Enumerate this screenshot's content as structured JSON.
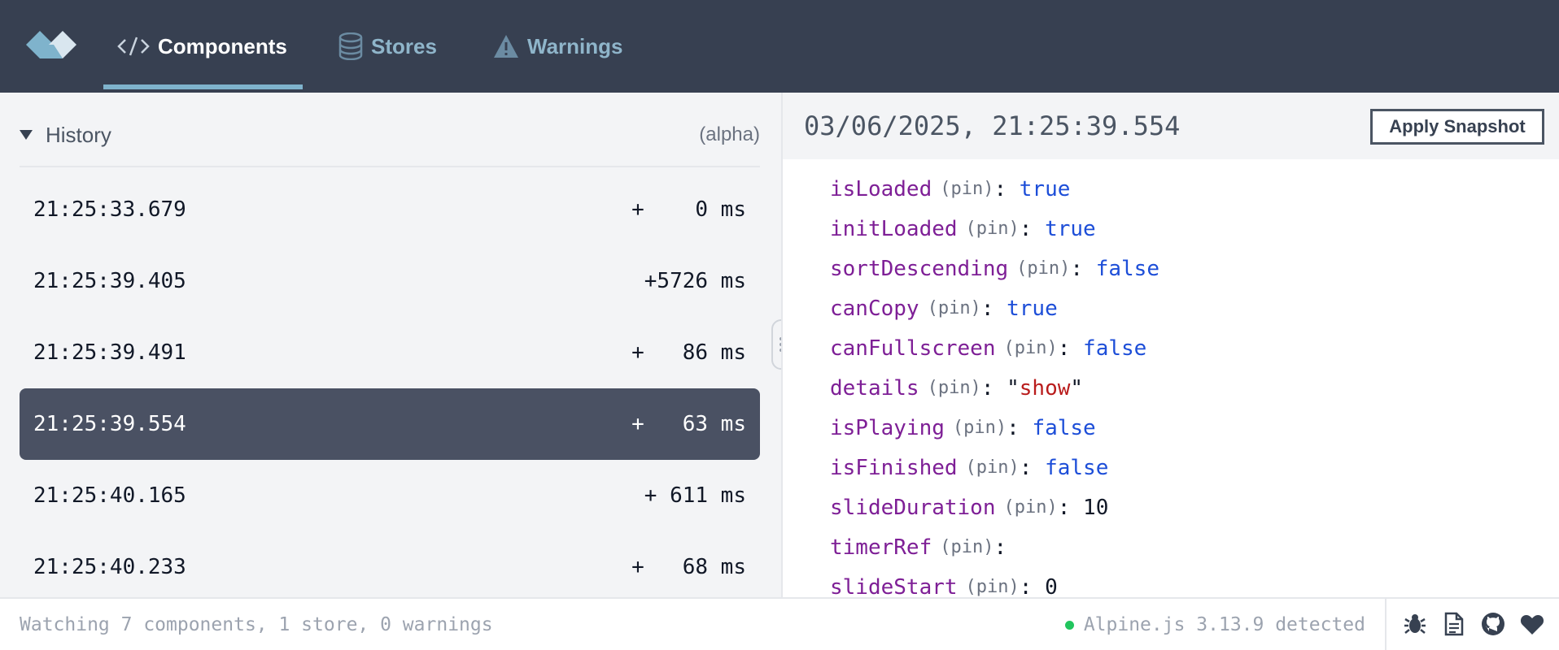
{
  "nav": {
    "tabs": [
      {
        "label": "Components",
        "icon": "code-icon",
        "active": true
      },
      {
        "label": "Stores",
        "icon": "database-icon",
        "active": false
      },
      {
        "label": "Warnings",
        "icon": "warning-icon",
        "active": false
      }
    ]
  },
  "history": {
    "title": "History",
    "badge": "(alpha)",
    "rows": [
      {
        "time": "21:25:33.679",
        "delta": "+    0 ms"
      },
      {
        "time": "21:25:39.405",
        "delta": "+5726 ms"
      },
      {
        "time": "21:25:39.491",
        "delta": "+   86 ms"
      },
      {
        "time": "21:25:39.554",
        "delta": "+   63 ms",
        "selected": true
      },
      {
        "time": "21:25:40.165",
        "delta": "+ 611 ms"
      },
      {
        "time": "21:25:40.233",
        "delta": "+   68 ms"
      }
    ]
  },
  "snapshot": {
    "timestamp": "03/06/2025, 21:25:39.554",
    "apply_label": "Apply Snapshot",
    "pin_label": "(pin)",
    "props": [
      {
        "name": "isLoaded",
        "value": "true",
        "type": "bool"
      },
      {
        "name": "initLoaded",
        "value": "true",
        "type": "bool"
      },
      {
        "name": "sortDescending",
        "value": "false",
        "type": "bool"
      },
      {
        "name": "canCopy",
        "value": "true",
        "type": "bool"
      },
      {
        "name": "canFullscreen",
        "value": "false",
        "type": "bool"
      },
      {
        "name": "details",
        "value": "show",
        "type": "string"
      },
      {
        "name": "isPlaying",
        "value": "false",
        "type": "bool"
      },
      {
        "name": "isFinished",
        "value": "false",
        "type": "bool"
      },
      {
        "name": "slideDuration",
        "value": "10",
        "type": "number"
      },
      {
        "name": "timerRef",
        "value": "",
        "type": "empty"
      },
      {
        "name": "slideStart",
        "value": "0",
        "type": "number"
      }
    ]
  },
  "footer": {
    "status": "Watching 7 components, 1 store, 0 warnings",
    "detected": "Alpine.js 3.13.9 detected",
    "icons": [
      "bug-icon",
      "document-icon",
      "github-icon",
      "heart-icon"
    ]
  },
  "colors": {
    "nav_bg": "#374051",
    "accent": "#7fb3cc",
    "selected_row": "#4a5163",
    "prop_name": "#7e1f96",
    "bool_value": "#1d4ed8",
    "string_value": "#b91c1c",
    "status_dot": "#22c55e"
  }
}
